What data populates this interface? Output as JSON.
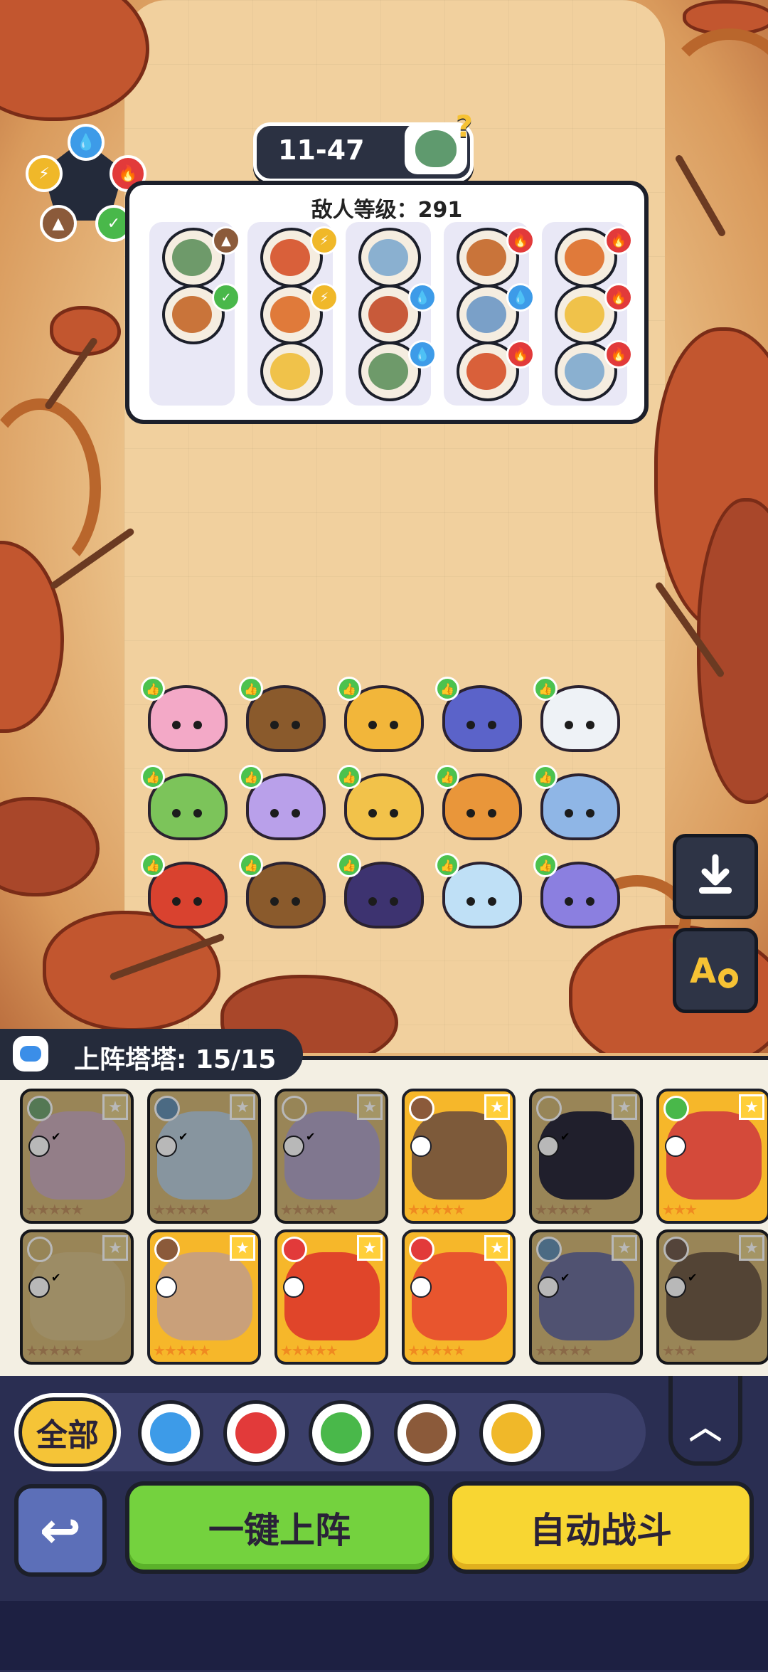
{
  "stage": {
    "label": "11-47"
  },
  "enemy_panel": {
    "title": "敌人等级：291",
    "columns": [
      {
        "enemies": [
          {
            "element": "earth"
          },
          {
            "element": "leaf"
          }
        ]
      },
      {
        "enemies": [
          {
            "element": "bolt"
          },
          {
            "element": "bolt"
          },
          {
            "element": "none"
          }
        ]
      },
      {
        "enemies": [
          {
            "element": "none"
          },
          {
            "element": "water"
          },
          {
            "element": "water"
          }
        ]
      },
      {
        "enemies": [
          {
            "element": "fire"
          },
          {
            "element": "water"
          },
          {
            "element": "fire"
          }
        ]
      },
      {
        "enemies": [
          {
            "element": "fire"
          },
          {
            "element": "fire"
          },
          {
            "element": "fire"
          }
        ]
      }
    ]
  },
  "element_wheel": {
    "nodes": [
      "water",
      "fire",
      "leaf",
      "earth",
      "bolt"
    ]
  },
  "deployed": [
    {
      "color": "#f3a9c7"
    },
    {
      "color": "#8a5a2c"
    },
    {
      "color": "#f2b63a"
    },
    {
      "color": "#5b63c9"
    },
    {
      "color": "#eef2f6"
    },
    {
      "color": "#7cc45a"
    },
    {
      "color": "#b9a0ea"
    },
    {
      "color": "#f2c24a"
    },
    {
      "color": "#e9963a"
    },
    {
      "color": "#8fb6e6"
    },
    {
      "color": "#d9422f"
    },
    {
      "color": "#8a5a2c"
    },
    {
      "color": "#3d3370"
    },
    {
      "color": "#bfe0f6"
    },
    {
      "color": "#8b7fe0"
    }
  ],
  "roster": {
    "label": "上阵塔塔: 15/15",
    "cards": [
      {
        "element": "leaf",
        "color": "#e7a6c4",
        "used": true,
        "stars": "★★★★★"
      },
      {
        "element": "water",
        "color": "#a8d3f2",
        "used": true,
        "stars": "★★★★★"
      },
      {
        "element": "bolt",
        "color": "#b9a0ea",
        "used": true,
        "stars": "★★★★★"
      },
      {
        "element": "earth",
        "color": "#7d5a3a",
        "used": false,
        "stars": "★★★★★"
      },
      {
        "element": "bolt",
        "color": "#2c2a50",
        "used": true,
        "stars": "★★★★★"
      },
      {
        "element": "leaf",
        "color": "#d44a3a",
        "used": false,
        "stars": "★★★"
      },
      {
        "element": "bolt",
        "color": "#f2c24a",
        "used": true,
        "stars": "★★★★★"
      },
      {
        "element": "earth",
        "color": "#c9a07a",
        "used": false,
        "stars": "★★★★★"
      },
      {
        "element": "fire",
        "color": "#e0452a",
        "used": false,
        "stars": "★★★★★"
      },
      {
        "element": "fire",
        "color": "#e8552e",
        "used": false,
        "stars": "★★★★★"
      },
      {
        "element": "water",
        "color": "#6a6ed0",
        "used": true,
        "stars": "★★★★★"
      },
      {
        "element": "earth",
        "color": "#8a5a2c",
        "used": true,
        "stars": "★★★"
      }
    ]
  },
  "filters": {
    "all_label": "全部",
    "elements": [
      "water",
      "fire",
      "leaf",
      "earth",
      "bolt"
    ]
  },
  "buttons": {
    "auto_deploy": "一键上阵",
    "auto_battle": "自动战斗"
  }
}
